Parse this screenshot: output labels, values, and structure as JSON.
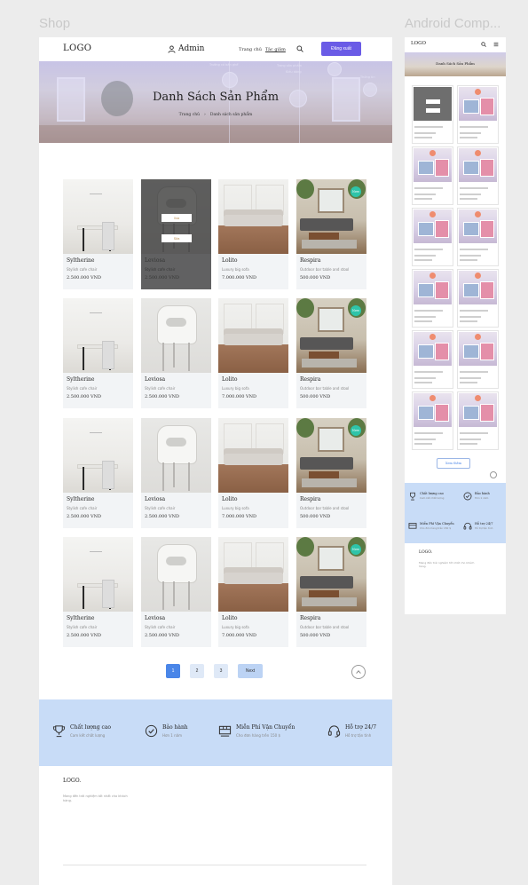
{
  "frames": {
    "shop": "Shop",
    "android": "Android Comp..."
  },
  "header": {
    "logo": "LOGO",
    "admin": "Admin",
    "nav": [
      "Trang chủ",
      "Tác giảm"
    ],
    "logout": "Đăng xuất"
  },
  "banner": {
    "title": "Danh Sách Sản Phẩm",
    "breadcrumb": [
      "Trang chủ",
      "Danh sách sản phẩm"
    ],
    "tiny_labels": [
      "Trường cổ bản ghế",
      "Trang sản phẩm",
      "Kiểu dáng",
      "Thống tin"
    ]
  },
  "products": [
    {
      "name": "Syltherine",
      "desc": "Stylish cafe chair",
      "price": "2.500.000 VND",
      "img": "syl",
      "new": false
    },
    {
      "name": "Leviosa",
      "desc": "Stylish cafe chair",
      "price": "2.500.000 VND",
      "img": "lev",
      "new": false,
      "hover": true
    },
    {
      "name": "Lolito",
      "desc": "Luxury big sofa",
      "price": "7.000.000 VND",
      "img": "lol",
      "new": false
    },
    {
      "name": "Respira",
      "desc": "Outdoor bar table and stool",
      "price": "500.000 VND",
      "img": "res",
      "new": true
    },
    {
      "name": "Syltherine",
      "desc": "Stylish cafe chair",
      "price": "2.500.000 VND",
      "img": "syl",
      "new": false
    },
    {
      "name": "Leviosa",
      "desc": "Stylish cafe chair",
      "price": "2.500.000 VND",
      "img": "lev",
      "new": false
    },
    {
      "name": "Lolito",
      "desc": "Luxury big sofa",
      "price": "7.000.000 VND",
      "img": "lol",
      "new": false
    },
    {
      "name": "Respira",
      "desc": "Outdoor bar table and stool",
      "price": "500.000 VND",
      "img": "res",
      "new": true
    },
    {
      "name": "Syltherine",
      "desc": "Stylish cafe chair",
      "price": "2.500.000 VND",
      "img": "syl",
      "new": false
    },
    {
      "name": "Leviosa",
      "desc": "Stylish cafe chair",
      "price": "2.500.000 VND",
      "img": "lev",
      "new": false
    },
    {
      "name": "Lolito",
      "desc": "Luxury big sofa",
      "price": "7.000.000 VND",
      "img": "lol",
      "new": false
    },
    {
      "name": "Respira",
      "desc": "Outdoor bar table and stool",
      "price": "500.000 VND",
      "img": "res",
      "new": true
    },
    {
      "name": "Syltherine",
      "desc": "Stylish cafe chair",
      "price": "2.500.000 VND",
      "img": "syl",
      "new": false
    },
    {
      "name": "Leviosa",
      "desc": "Stylish cafe chair",
      "price": "2.500.000 VND",
      "img": "lev",
      "new": false
    },
    {
      "name": "Lolito",
      "desc": "Luxury big sofa",
      "price": "7.000.000 VND",
      "img": "lol",
      "new": false
    },
    {
      "name": "Respira",
      "desc": "Outdoor bar table and stool",
      "price": "500.000 VND",
      "img": "res",
      "new": true
    }
  ],
  "badge_new": "New",
  "hover_buttons": [
    "Xóa",
    "Sửa"
  ],
  "pagination": {
    "pages": [
      "1",
      "2",
      "3"
    ],
    "next": "Next",
    "current": "1"
  },
  "features": [
    {
      "title": "Chất lượng cao",
      "sub": "Cam kết chất lượng",
      "icon": "trophy-icon"
    },
    {
      "title": "Bảo hành",
      "sub": "Hơn 1 năm",
      "icon": "check-circle-icon"
    },
    {
      "title": "Miễn Phí Vận Chuyển",
      "sub": "Cho đơn hàng trên 150 $",
      "icon": "shipping-icon"
    },
    {
      "title": "Hỗ trợ 24/7",
      "sub": "Hỗ trợ tận tình",
      "icon": "headset-icon"
    }
  ],
  "footer": {
    "logo": "LOGO.",
    "desc": "Mang đến trải nghiệm tốt nhất cho khách hàng."
  },
  "android": {
    "logo": "LOGO",
    "banner_title": "Danh Sách Sản Phẩm",
    "more": "Xem thêm",
    "footer_logo": "LOGO.",
    "footer_desc": "Mang đến trải nghiệm tốt nhất cho khách hàng.",
    "features": [
      {
        "title": "Chất lượng cao",
        "sub": "Cam kết chất lượng"
      },
      {
        "title": "Bảo hành",
        "sub": "Hơn 1 năm"
      },
      {
        "title": "Miễn Phí Vận Chuyển",
        "sub": "Cho đơn hàng trên 150 $"
      },
      {
        "title": "Hỗ trợ 24/7",
        "sub": "Hỗ trợ tận tình"
      }
    ]
  },
  "colors": {
    "accent": "#6a5be6",
    "page_active": "#4a86e8",
    "feature_bg": "#c8dcf7",
    "badge": "#2ec4a9"
  }
}
